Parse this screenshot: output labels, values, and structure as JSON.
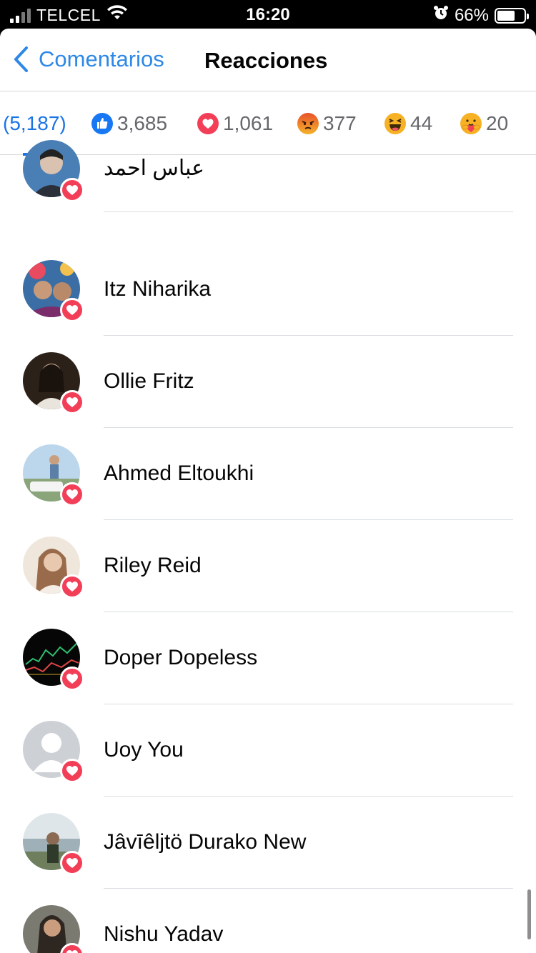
{
  "status_bar": {
    "carrier": "TELCEL",
    "time": "16:20",
    "battery": "66%",
    "battery_level": 0.66,
    "signal_bars_active": 2,
    "icons": [
      "signal-icon",
      "wifi-icon",
      "alarm-icon",
      "battery-icon"
    ]
  },
  "nav": {
    "back_label": "Comentarios",
    "title": "Reacciones"
  },
  "reaction_tabs": [
    {
      "label": "(5,187)",
      "icon": "all"
    },
    {
      "label": "3,685",
      "icon": "like-icon",
      "color": "#1877f2"
    },
    {
      "label": "1,061",
      "icon": "love-icon",
      "color": "#f33e58"
    },
    {
      "label": "377",
      "icon": "angry-icon",
      "color": "#e9710f"
    },
    {
      "label": "44",
      "icon": "haha-icon",
      "color": "#f7b125"
    },
    {
      "label": "20",
      "icon": "care-icon",
      "color": "#f7b125"
    }
  ],
  "people": [
    {
      "name": "عباس احمد",
      "reaction": "love-icon"
    },
    {
      "name": "Itz Niharika",
      "reaction": "love-icon"
    },
    {
      "name": "Ollie Fritz",
      "reaction": "love-icon"
    },
    {
      "name": "Ahmed Eltoukhi",
      "reaction": "love-icon"
    },
    {
      "name": "Riley Reid",
      "reaction": "love-icon"
    },
    {
      "name": "Doper Dopeless",
      "reaction": "love-icon"
    },
    {
      "name": "Uoy You",
      "reaction": "love-icon"
    },
    {
      "name": "Jâvīêljtö Durako New",
      "reaction": "love-icon"
    },
    {
      "name": "Nishu Yadav",
      "reaction": "love-icon"
    }
  ],
  "colors": {
    "accent": "#2d88e6",
    "love": "#f33e58",
    "text": "#050505",
    "muted": "#65676b"
  }
}
